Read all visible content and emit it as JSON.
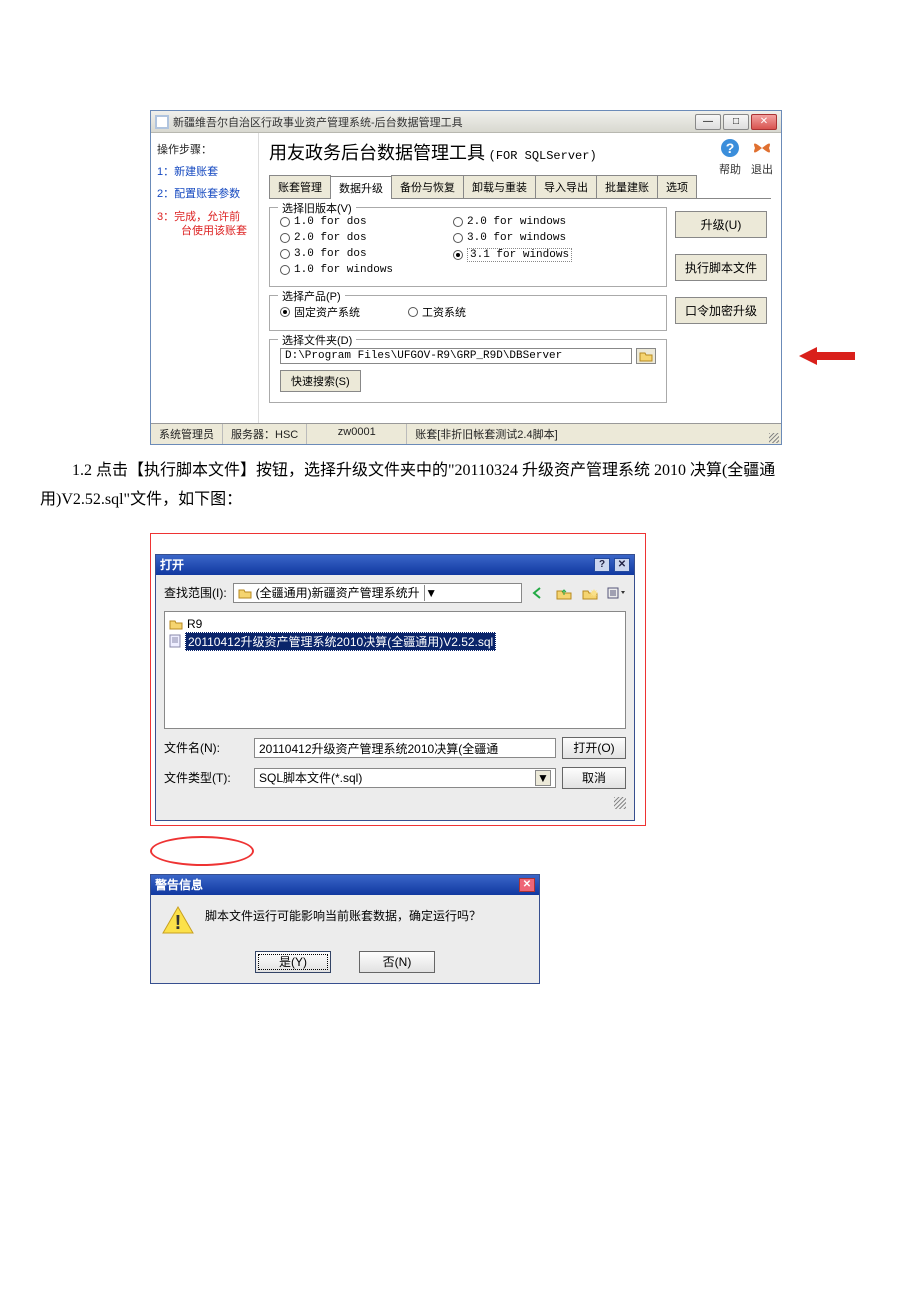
{
  "body_text": {
    "para": "1.2 点击【执行脚本文件】按钮，选择升级文件夹中的\"20110324 升级资产管理系统 2010 决算(全疆通用)V2.52.sql\"文件，如下图："
  },
  "win1": {
    "title": "新疆维吾尔自治区行政事业资产管理系统-后台数据管理工具",
    "main_title": "用友政务后台数据管理工具",
    "main_sub": "(FOR SQLServer)",
    "toolbar_help": "帮助",
    "toolbar_exit": "退出",
    "tabs": [
      "账套管理",
      "数据升级",
      "备份与恢复",
      "卸载与重装",
      "导入导出",
      "批量建账",
      "选项"
    ],
    "steps_title": "操作步骤：",
    "step1": "1：新建账套",
    "step2": "2：配置账套参数",
    "step3a": "3：完成，允许前",
    "step3b": "台使用该账套",
    "group_version": {
      "legend": "选择旧版本(V)",
      "left": [
        "1.0 for dos",
        "2.0 for dos",
        "3.0 for dos",
        "1.0 for windows"
      ],
      "right": [
        "2.0 for windows",
        "3.0 for windows",
        "3.1 for windows"
      ]
    },
    "group_product": {
      "legend": "选择产品(P)",
      "opt1": "固定资产系统",
      "opt2": "工资系统"
    },
    "group_folder": {
      "legend": "选择文件夹(D)",
      "path": "D:\\Program Files\\UFGOV-R9\\GRP_R9D\\DBServer",
      "quick_search": "快速搜索(S)"
    },
    "side_buttons": {
      "upgrade": "升级(U)",
      "exec_script": "执行脚本文件",
      "pwd_upgrade": "口令加密升级"
    },
    "status": {
      "user": "系统管理员",
      "server_lbl": "服务器：",
      "server_val": "HSC",
      "code": "zw0001",
      "acct": "账套[非折旧帐套测试2.4脚本]"
    }
  },
  "win2": {
    "title": "打开",
    "look_in_lbl": "查找范围(I):",
    "look_in_val": "(全疆通用)新疆资产管理系统升",
    "folder_item": "R9",
    "file_item": "20110412升级资产管理系统2010决算(全疆通用)V2.52.sql",
    "filename_lbl": "文件名(N):",
    "filename_val": "20110412升级资产管理系统2010决算(全疆通",
    "filetype_lbl": "文件类型(T):",
    "filetype_val": "SQL脚本文件(*.sql)",
    "open_btn": "打开(O)",
    "cancel_btn": "取消"
  },
  "win3": {
    "title": "警告信息",
    "message": "脚本文件运行可能影响当前账套数据，确定运行吗？",
    "yes": "是(Y)",
    "no": "否(N)"
  }
}
